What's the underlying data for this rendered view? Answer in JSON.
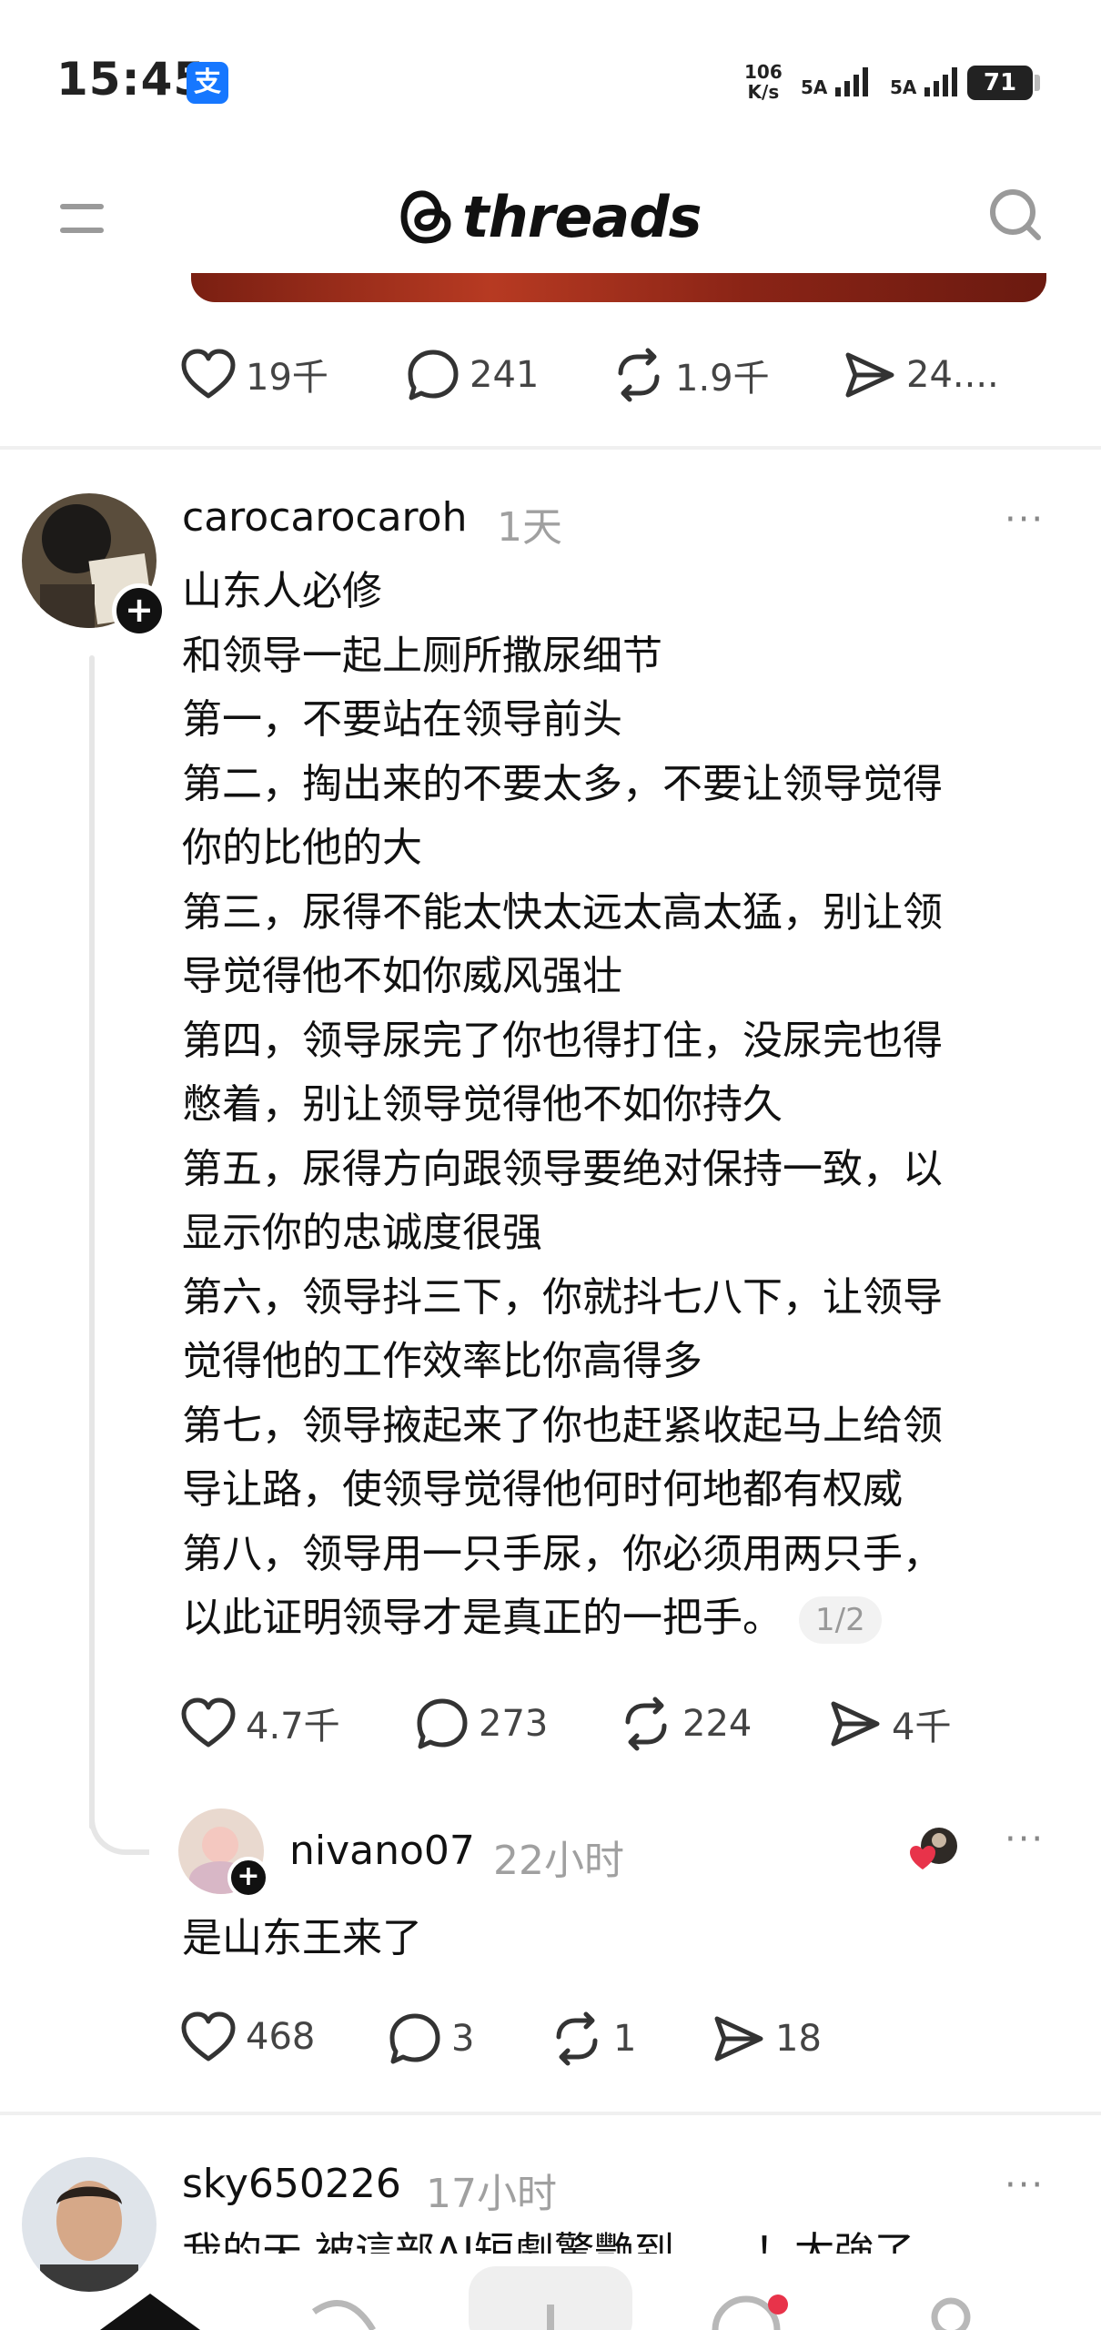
{
  "status_bar": {
    "time": "15:45",
    "app_icon": "支",
    "net_speed_value": "106",
    "net_speed_unit": "K/s",
    "signal1": "5A",
    "signal2": "5A",
    "battery": "71"
  },
  "header": {
    "logo_text": "threads",
    "icons": [
      "menu-icon",
      "threads-logo-icon",
      "search-icon"
    ]
  },
  "top_post": {
    "likes": "19千",
    "replies": "241",
    "reposts": "1.9千",
    "shares": "24...."
  },
  "main_post": {
    "username": "carocarocaroh",
    "time": "1天",
    "lines": [
      "山东人必修",
      "和领导一起上厕所撒尿细节",
      "第一，不要站在领导前头",
      "第二，掏出来的不要太多，不要让领导觉得",
      "你的比他的大",
      "第三，尿得不能太快太远太高太猛，别让领",
      "导觉得他不如你威风强壮",
      "第四，领导尿完了你也得打住，没尿完也得",
      "憋着，别让领导觉得他不如你持久",
      "第五，尿得方向跟领导要绝对保持一致，以",
      "显示你的忠诚度很强",
      "第六，领导抖三下，你就抖七八下，让领导",
      "觉得他的工作效率比你高得多",
      "第七，领导掖起来了你也赶紧收起马上给领",
      "导让路，使领导觉得他何时何地都有权威",
      "第八，领导用一只手尿，你必须用两只手，",
      "以此证明领导才是真正的一把手。"
    ],
    "page_indicator": "1/2",
    "likes": "4.7千",
    "replies": "273",
    "reposts": "224",
    "shares": "4千"
  },
  "reply_post": {
    "username": "nivano07",
    "time": "22小时",
    "text": "是山东王来了",
    "likes": "468",
    "replies": "3",
    "reposts": "1",
    "shares": "18"
  },
  "next_post": {
    "username": "sky650226",
    "time": "17小时",
    "partial_text": "我的天 被這部AI短劇驚艷到……！太強了"
  },
  "more_label": "···",
  "plus_label": "+",
  "colors": {
    "accent": "#111111",
    "muted": "#a0a0a0",
    "like_heart": "#e8334a",
    "alipay_blue": "#1677ff"
  }
}
